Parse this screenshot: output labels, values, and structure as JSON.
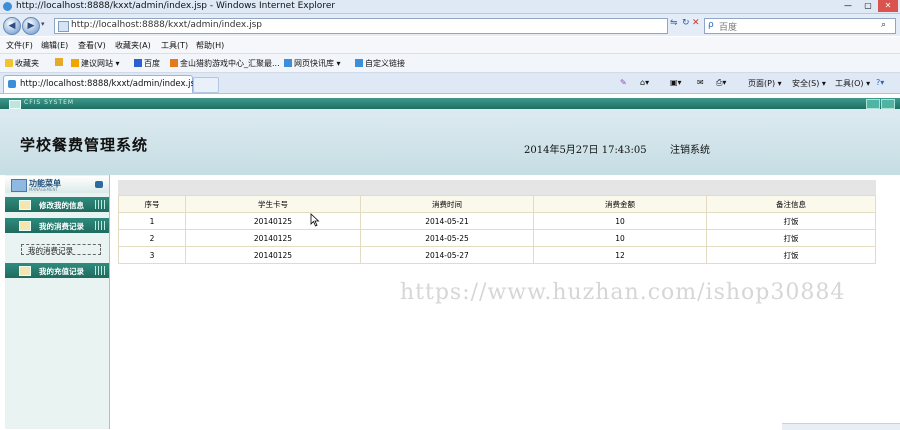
{
  "browser": {
    "window_title": "http://localhost:8888/kxxt/admin/index.jsp - Windows Internet Explorer",
    "address": "http://localhost:8888/kxxt/admin/index.jsp",
    "search_placeholder": "百度",
    "menu": [
      "文件(F)",
      "编辑(E)",
      "查看(V)",
      "收藏夹(A)",
      "工具(T)",
      "帮助(H)"
    ],
    "favorites": {
      "label": "收藏夹",
      "items": [
        "建议网站 ▾",
        "百度",
        "金山猎豹游戏中心_汇聚最...",
        "网页快讯库 ▾",
        "自定义链接"
      ]
    },
    "tab_label": "http://localhost:8888/kxxt/admin/index.jsp",
    "commands": [
      "页面(P) ▾",
      "安全(S) ▾",
      "工具(O) ▾"
    ]
  },
  "app": {
    "frame_title": "CFIS SYSTEM",
    "title": "学校餐费管理系统",
    "datetime": "2014年5月27日  17:43:05",
    "logout": "注销系统",
    "sidebar": {
      "head": "功能菜单",
      "head_sub": "MANAGEMENT",
      "items": [
        "修改我的信息",
        "我的消费记录",
        "我的充值记录"
      ],
      "subitem": "我的消费记录"
    },
    "table": {
      "headers": [
        "序号",
        "学生卡号",
        "消费时间",
        "消费金额",
        "备注信息"
      ],
      "rows": [
        [
          "1",
          "20140125",
          "2014-05-21",
          "10",
          "打饭"
        ],
        [
          "2",
          "20140125",
          "2014-05-25",
          "10",
          "打饭"
        ],
        [
          "3",
          "20140125",
          "2014-05-27",
          "12",
          "打饭"
        ]
      ]
    },
    "watermark": "https://www.huzhan.com/ishop30884"
  }
}
